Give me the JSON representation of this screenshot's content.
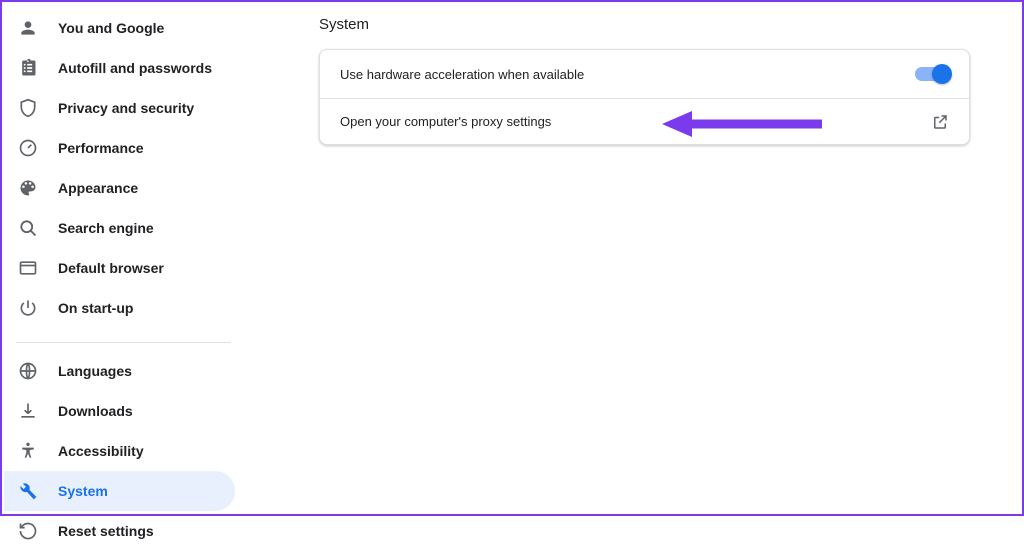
{
  "sidebar": {
    "groups": [
      {
        "items": [
          {
            "label": "You and Google",
            "icon": "person-icon",
            "selected": false
          },
          {
            "label": "Autofill and passwords",
            "icon": "clipboard-icon",
            "selected": false
          },
          {
            "label": "Privacy and security",
            "icon": "shield-icon",
            "selected": false
          },
          {
            "label": "Performance",
            "icon": "speedometer-icon",
            "selected": false
          },
          {
            "label": "Appearance",
            "icon": "palette-icon",
            "selected": false
          },
          {
            "label": "Search engine",
            "icon": "magnify-icon",
            "selected": false
          },
          {
            "label": "Default browser",
            "icon": "browser-icon",
            "selected": false
          },
          {
            "label": "On start-up",
            "icon": "power-icon",
            "selected": false
          }
        ]
      },
      {
        "items": [
          {
            "label": "Languages",
            "icon": "globe-icon",
            "selected": false
          },
          {
            "label": "Downloads",
            "icon": "download-icon",
            "selected": false
          },
          {
            "label": "Accessibility",
            "icon": "accessibility-icon",
            "selected": false
          },
          {
            "label": "System",
            "icon": "wrench-icon",
            "selected": true
          },
          {
            "label": "Reset settings",
            "icon": "restore-icon",
            "selected": false
          }
        ]
      }
    ]
  },
  "main": {
    "title": "System",
    "rows": {
      "hw_accel_label": "Use hardware acceleration when available",
      "hw_accel_on": true,
      "proxy_label": "Open your computer's proxy settings"
    }
  },
  "annotation": {
    "arrow_color": "#7c3aed"
  }
}
